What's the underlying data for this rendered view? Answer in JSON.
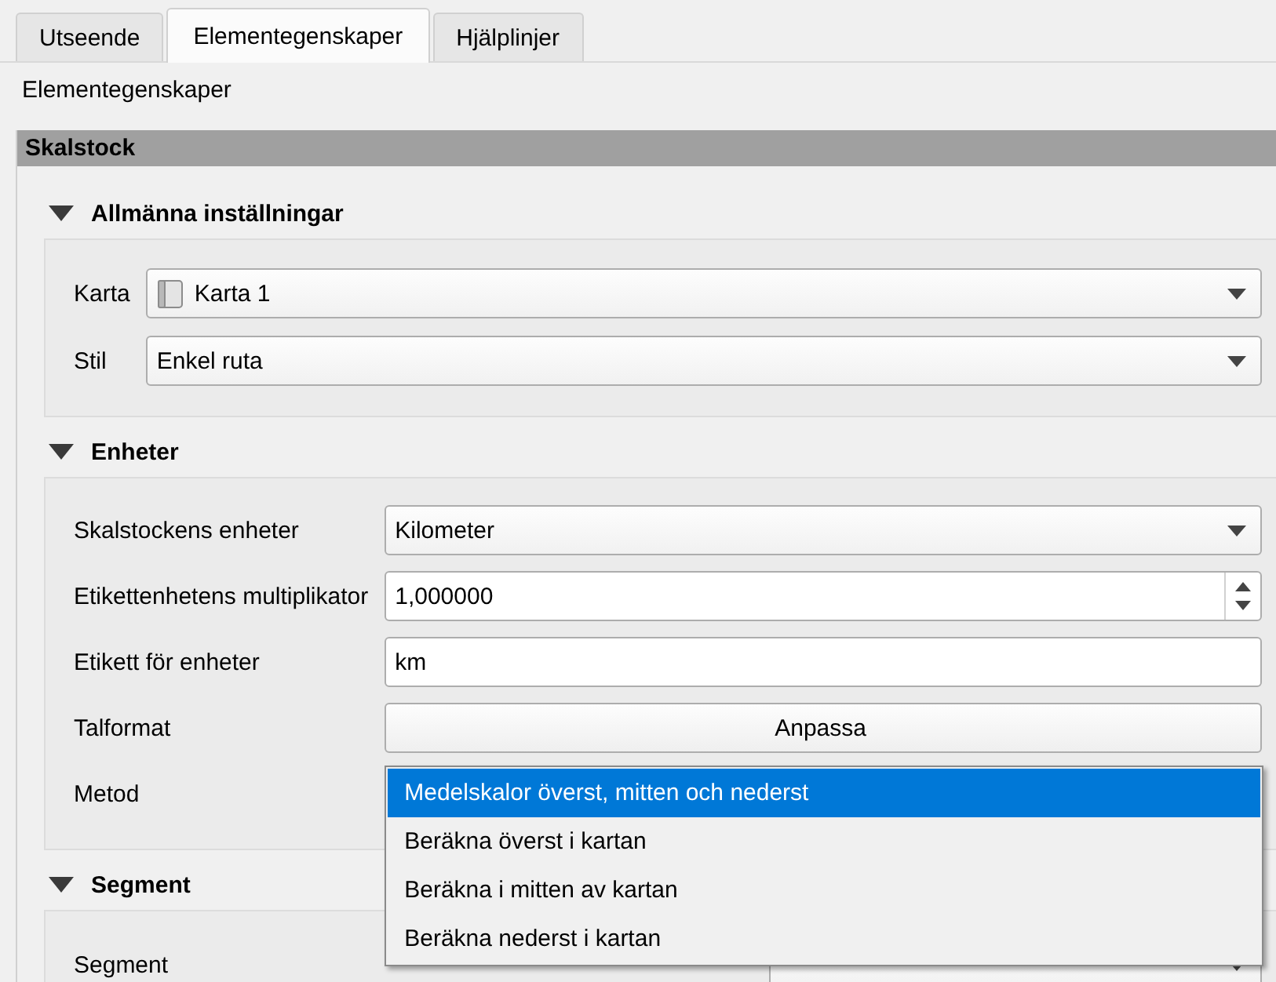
{
  "tabs": [
    {
      "label": "Utseende",
      "selected": false
    },
    {
      "label": "Elementegenskaper",
      "selected": true
    },
    {
      "label": "Hjälplinjer",
      "selected": false
    }
  ],
  "panel_title": "Elementegenskaper",
  "section": "Skalstock",
  "groups": [
    {
      "title": "Allmänna inställningar",
      "expanded": true,
      "rows": [
        {
          "label": "Karta",
          "kind": "map-combo",
          "value": "Karta 1"
        },
        {
          "label": "Stil",
          "kind": "combo",
          "value": "Enkel ruta"
        }
      ]
    },
    {
      "title": "Enheter",
      "expanded": true,
      "rows": [
        {
          "label": "Skalstockens enheter",
          "kind": "combo",
          "value": "Kilometer"
        },
        {
          "label": "Etikettenhetens multiplikator",
          "kind": "spin",
          "value": "1,000000"
        },
        {
          "label": "Etikett för enheter",
          "kind": "text",
          "value": "km"
        },
        {
          "label": "Talformat",
          "kind": "button",
          "value": "Anpassa"
        },
        {
          "label": "Metod",
          "kind": "open-combo",
          "options": [
            {
              "label": "Medelskalor överst, mitten och nederst",
              "selected": true
            },
            {
              "label": "Beräkna överst i kartan",
              "selected": false
            },
            {
              "label": "Beräkna i mitten av kartan",
              "selected": false
            },
            {
              "label": "Beräkna nederst i kartan",
              "selected": false
            }
          ]
        }
      ]
    },
    {
      "title": "Segment",
      "expanded": true,
      "rows": [
        {
          "label": "Segment",
          "kind": "combo"
        }
      ]
    }
  ]
}
